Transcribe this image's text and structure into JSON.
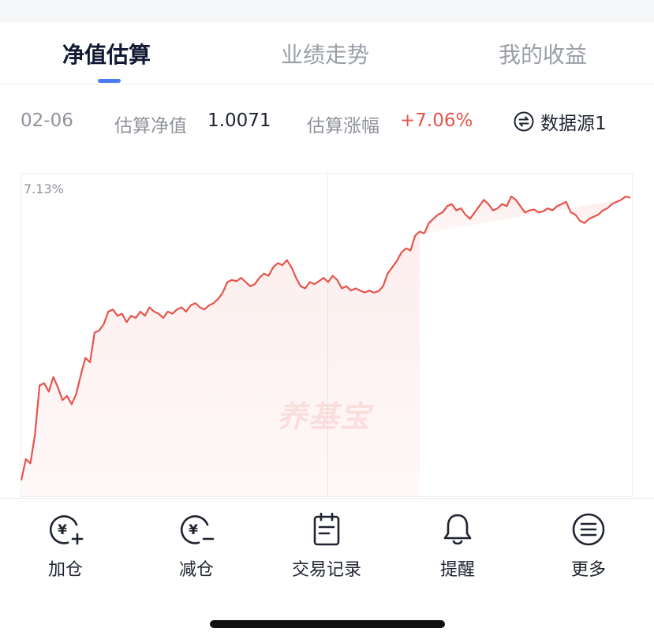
{
  "tabs": [
    {
      "label": "净值估算",
      "active": true
    },
    {
      "label": "业绩走势",
      "active": false
    },
    {
      "label": "我的收益",
      "active": false
    }
  ],
  "info": {
    "date": "02-06",
    "nav_label": "估算净值",
    "nav_value": "1.0071",
    "change_label": "估算涨幅",
    "change_value": "+7.06%",
    "source_label": "数据源1",
    "source_icon": "swap-arrows-icon"
  },
  "colors": {
    "accent": "#4c7cf0",
    "up": "#e5544d",
    "title": "#121a33"
  },
  "chart_data": {
    "type": "area",
    "max_label": "7.13%",
    "ylim": [
      0,
      7.13
    ],
    "grid": "vertical-midline",
    "watermark": "养基宝",
    "y": [
      0.4,
      0.9,
      0.8,
      1.5,
      2.65,
      2.7,
      2.5,
      2.85,
      2.6,
      2.3,
      2.4,
      2.2,
      2.45,
      2.9,
      3.3,
      3.2,
      3.9,
      3.95,
      4.1,
      4.4,
      4.45,
      4.3,
      4.35,
      4.15,
      4.3,
      4.25,
      4.4,
      4.3,
      4.5,
      4.4,
      4.35,
      4.25,
      4.4,
      4.35,
      4.45,
      4.5,
      4.4,
      4.55,
      4.6,
      4.5,
      4.45,
      4.55,
      4.6,
      4.7,
      4.85,
      5.1,
      5.15,
      5.12,
      5.2,
      5.1,
      5.0,
      5.05,
      5.2,
      5.3,
      5.25,
      5.45,
      5.55,
      5.5,
      5.62,
      5.45,
      5.2,
      5.0,
      4.95,
      5.1,
      5.05,
      5.12,
      5.2,
      5.1,
      5.25,
      5.15,
      4.95,
      5.0,
      4.9,
      4.95,
      4.9,
      4.85,
      4.9,
      4.85,
      4.88,
      5.0,
      5.3,
      5.45,
      5.6,
      5.8,
      5.9,
      5.85,
      6.2,
      6.3,
      6.25,
      6.5,
      6.6,
      6.7,
      6.75,
      6.9,
      6.95,
      6.8,
      6.85,
      6.7,
      6.6,
      6.75,
      6.9,
      7.05,
      6.95,
      6.8,
      6.85,
      6.95,
      6.9,
      7.13,
      7.05,
      6.9,
      6.75,
      6.8,
      6.82,
      6.75,
      6.78,
      6.85,
      6.8,
      6.9,
      6.95,
      7.0,
      6.75,
      6.7,
      6.55,
      6.5,
      6.6,
      6.65,
      6.7,
      6.8,
      6.85,
      6.95,
      7.0,
      7.05,
      7.13,
      7.1
    ],
    "segments": [
      {
        "start": 0,
        "end": 87
      },
      {
        "start": 88,
        "end": 135
      }
    ]
  },
  "actions": [
    {
      "label": "加仓",
      "icon": "add-position-icon"
    },
    {
      "label": "减仓",
      "icon": "reduce-position-icon"
    },
    {
      "label": "交易记录",
      "icon": "trade-record-icon"
    },
    {
      "label": "提醒",
      "icon": "bell-icon"
    },
    {
      "label": "更多",
      "icon": "more-menu-icon"
    }
  ]
}
